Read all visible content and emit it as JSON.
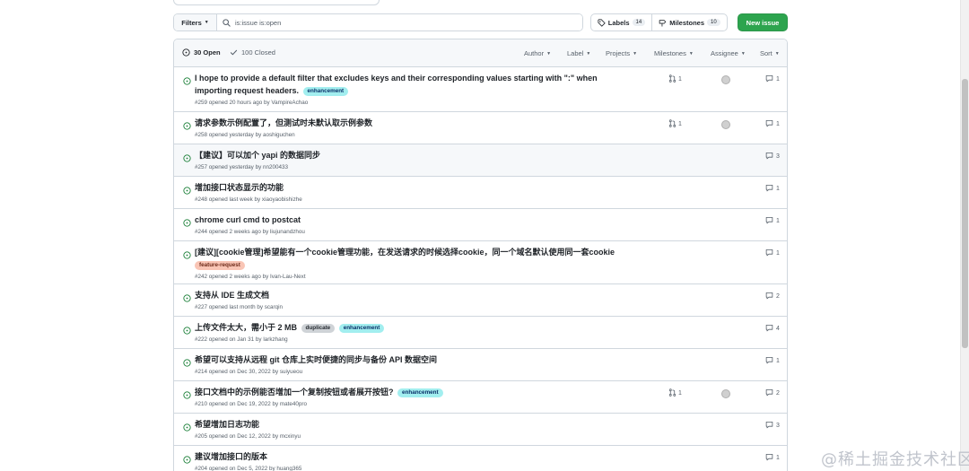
{
  "toolbar": {
    "filters_label": "Filters",
    "search_value": "is:issue is:open",
    "labels_label": "Labels",
    "labels_count": "14",
    "milestones_label": "Milestones",
    "milestones_count": "10",
    "new_issue_label": "New issue"
  },
  "header": {
    "open_label": "30 Open",
    "closed_label": "100 Closed",
    "filters": [
      "Author",
      "Label",
      "Projects",
      "Milestones",
      "Assignee",
      "Sort"
    ]
  },
  "issues": [
    {
      "title": "I hope to provide a default filter that excludes keys and their corresponding values starting with \":\" when importing request headers.",
      "labels": [
        {
          "name": "enhancement",
          "kind": "enh"
        }
      ],
      "meta": "#259 opened 20 hours ago by VampireAchao",
      "pr": "1",
      "has_avatar": true,
      "comments": "1"
    },
    {
      "title": "请求参数示例配置了，但测试时未默认取示例参数",
      "labels": [],
      "meta": "#258 opened yesterday by aoshiguchen",
      "pr": "1",
      "has_avatar": true,
      "comments": "1"
    },
    {
      "title": "【建议】可以加个 yapi 的数据同步",
      "labels": [],
      "meta": "#257 opened yesterday by nn200433",
      "pr": "",
      "has_avatar": false,
      "comments": "3"
    },
    {
      "title": "增加接口状态显示的功能",
      "labels": [],
      "meta": "#248 opened last week by xiaoyaobishizhe",
      "pr": "",
      "has_avatar": false,
      "comments": "1"
    },
    {
      "title": "chrome curl cmd to postcat",
      "labels": [],
      "meta": "#244 opened 2 weeks ago by liujunandzhou",
      "pr": "",
      "has_avatar": false,
      "comments": "1"
    },
    {
      "title": "[建议][cookie管理]希望能有一个cookie管理功能，在发送请求的时候选择cookie，同一个域名默认使用同一套cookie",
      "labels": [
        {
          "name": "feature-request",
          "kind": "feat"
        }
      ],
      "meta": "#242 opened 2 weeks ago by Ivan-Lau-Next",
      "pr": "",
      "has_avatar": false,
      "comments": "1"
    },
    {
      "title": "支持从 IDE 生成文档",
      "labels": [],
      "meta": "#227 opened last month by scarqin",
      "pr": "",
      "has_avatar": false,
      "comments": "2"
    },
    {
      "title": "上传文件太大，需小于 2 MB",
      "labels": [
        {
          "name": "duplicate",
          "kind": "dup"
        },
        {
          "name": "enhancement",
          "kind": "enh"
        }
      ],
      "meta": "#222 opened on Jan 31 by larkzhang",
      "pr": "",
      "has_avatar": false,
      "comments": "4"
    },
    {
      "title": "希望可以支持从远程 git 仓库上实时便捷的同步与备份 API 数据空间",
      "labels": [],
      "meta": "#214 opened on Dec 30, 2022 by suiyueou",
      "pr": "",
      "has_avatar": false,
      "comments": "1"
    },
    {
      "title": "接口文档中的示例能否增加一个复制按钮或者展开按钮?",
      "labels": [
        {
          "name": "enhancement",
          "kind": "enh"
        }
      ],
      "meta": "#210 opened on Dec 19, 2022 by mate40pro",
      "pr": "1",
      "has_avatar": true,
      "comments": "2"
    },
    {
      "title": "希望增加日志功能",
      "labels": [],
      "meta": "#205 opened on Dec 12, 2022 by mcxinyu",
      "pr": "",
      "has_avatar": false,
      "comments": "3"
    },
    {
      "title": "建议增加接口的版本",
      "labels": [],
      "meta": "#204 opened on Dec 5, 2022 by huang365",
      "pr": "",
      "has_avatar": false,
      "comments": "1"
    }
  ],
  "watermark": "@稀土掘金技术社区",
  "colors": {
    "accent_green": "#2da44e",
    "open_icon": "#1a7f37",
    "border": "#d0d7de",
    "enhancement": "#a2eeef",
    "feature_request": "#f9c5b5",
    "duplicate": "#cfd3d7"
  }
}
